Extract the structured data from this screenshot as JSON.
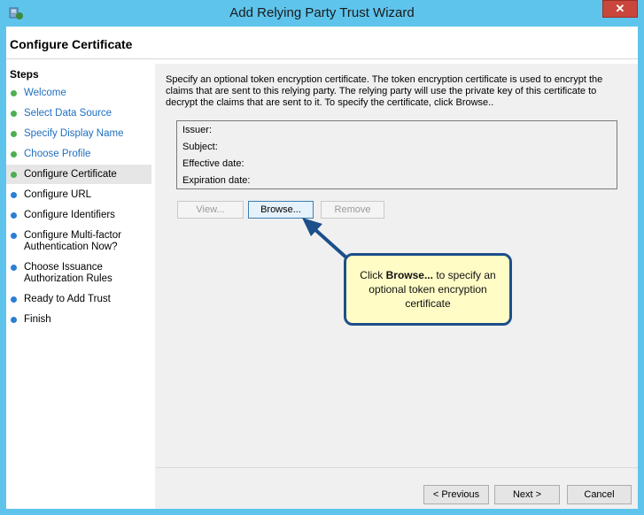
{
  "window": {
    "title": "Add Relying Party Trust Wizard",
    "close_label": "✕"
  },
  "page": {
    "title": "Configure Certificate"
  },
  "steps": {
    "heading": "Steps",
    "items": [
      {
        "label": "Welcome",
        "state": "done"
      },
      {
        "label": "Select Data Source",
        "state": "done"
      },
      {
        "label": "Specify Display Name",
        "state": "done"
      },
      {
        "label": "Choose Profile",
        "state": "done"
      },
      {
        "label": "Configure Certificate",
        "state": "current"
      },
      {
        "label": "Configure URL",
        "state": "todo"
      },
      {
        "label": "Configure Identifiers",
        "state": "todo"
      },
      {
        "label": "Configure Multi-factor Authentication Now?",
        "state": "todo"
      },
      {
        "label": "Choose Issuance Authorization Rules",
        "state": "todo"
      },
      {
        "label": "Ready to Add Trust",
        "state": "todo"
      },
      {
        "label": "Finish",
        "state": "todo"
      }
    ]
  },
  "content": {
    "description": "Specify an optional token encryption certificate.  The token encryption certificate is used to encrypt the claims that are sent to this relying party.  The relying party will use the private key of this certificate to decrypt the claims that are sent to it.  To specify the certificate, click Browse..",
    "fields": {
      "issuer": "Issuer:",
      "subject": "Subject:",
      "effective_date": "Effective date:",
      "expiration_date": "Expiration date:"
    },
    "buttons": {
      "view": "View...",
      "browse": "Browse...",
      "remove": "Remove"
    }
  },
  "callout": {
    "prefix": "Click ",
    "bold": "Browse...",
    "suffix": " to specify an optional token encryption certificate"
  },
  "footer": {
    "previous": "< Previous",
    "next": "Next >",
    "cancel": "Cancel"
  },
  "colors": {
    "titlebar": "#5fc4ec",
    "accent": "#1c4f8a",
    "step_done": "#4caf50",
    "step_todo": "#2a7fd4",
    "callout_bg": "#fffcc6"
  }
}
